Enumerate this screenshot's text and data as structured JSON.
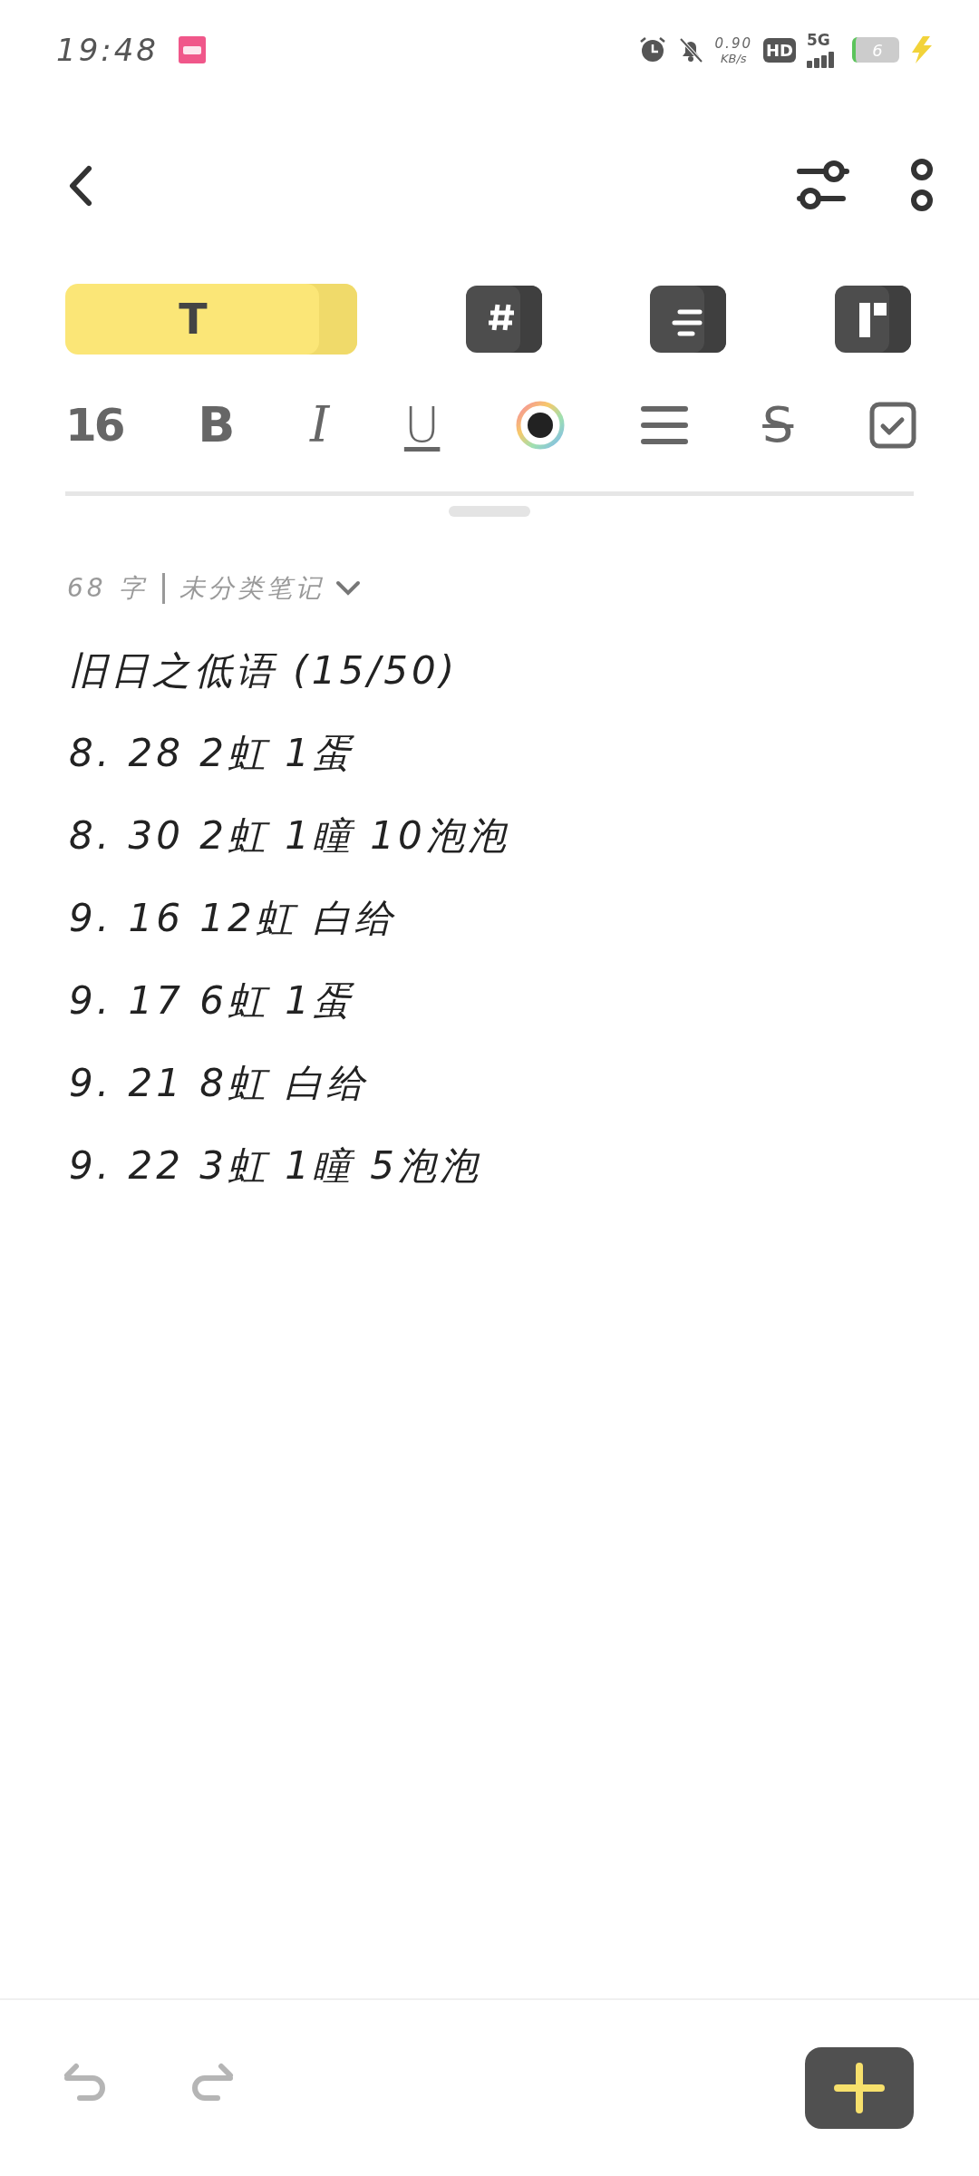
{
  "status_bar": {
    "time": "19:48",
    "net_speed": "0.90",
    "net_unit": "KB/s",
    "hd": "HD",
    "network": "5G",
    "battery": "6"
  },
  "tabs": [
    {
      "kind": "text",
      "label": "T",
      "selected": true
    },
    {
      "kind": "tag",
      "selected": false
    },
    {
      "kind": "list",
      "selected": false
    },
    {
      "kind": "grid",
      "selected": false
    }
  ],
  "format_tools": [
    {
      "kind": "size",
      "label": "16"
    },
    {
      "kind": "bold",
      "label": "B"
    },
    {
      "kind": "italic",
      "label": "I"
    },
    {
      "kind": "underline",
      "label": "U"
    },
    {
      "kind": "color"
    },
    {
      "kind": "align"
    },
    {
      "kind": "strike",
      "label": "S"
    },
    {
      "kind": "checklist"
    }
  ],
  "note": {
    "word_count": "68 字",
    "category": "未分类笔记",
    "lines": [
      "旧日之低语 (15/50)",
      "8. 28 2虹 1蛋",
      "8. 30 2虹 1瞳 10泡泡",
      "9. 16 12虹 白给",
      "9. 17 6虹 1蛋",
      "9. 21 8虹 白给",
      "9. 22 3虹 1瞳 5泡泡"
    ]
  },
  "bottom_bar": {
    "undo": {
      "disabled": true
    },
    "redo": {
      "disabled": true
    }
  }
}
